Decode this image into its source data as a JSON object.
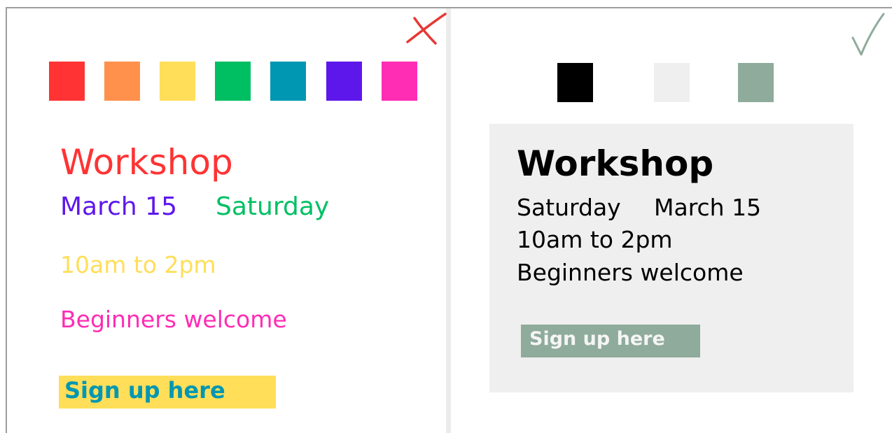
{
  "bad_example": {
    "mark_icon": "cross-icon",
    "mark_color": "#e53935",
    "swatches": [
      "#ff3333",
      "#ff914d",
      "#ffde59",
      "#00bf63",
      "#0097b2",
      "#5e17eb",
      "#ff2cb4"
    ],
    "title": "Workshop",
    "date": "March 15",
    "day": "Saturday",
    "time": "10am to 2pm",
    "audience": "Beginners welcome",
    "button_label": "Sign up here",
    "colors": {
      "title": "#ff3333",
      "date": "#5e17eb",
      "day": "#00bf63",
      "time": "#ffde59",
      "audience": "#ff2cb4",
      "button_text": "#0097b2",
      "button_bg": "#ffde59"
    }
  },
  "good_example": {
    "mark_icon": "check-icon",
    "mark_color": "#8fab9b",
    "swatches": [
      "#000000",
      "#efefef",
      "#8fab9b"
    ],
    "title": "Workshop",
    "day": "Saturday",
    "date": "March 15",
    "time": "10am to 2pm",
    "audience": "Beginners welcome",
    "button_label": "Sign up here",
    "colors": {
      "card_bg": "#efefef",
      "text": "#000000",
      "button_bg": "#8fab9b",
      "button_text": "#f5f5f5"
    }
  }
}
